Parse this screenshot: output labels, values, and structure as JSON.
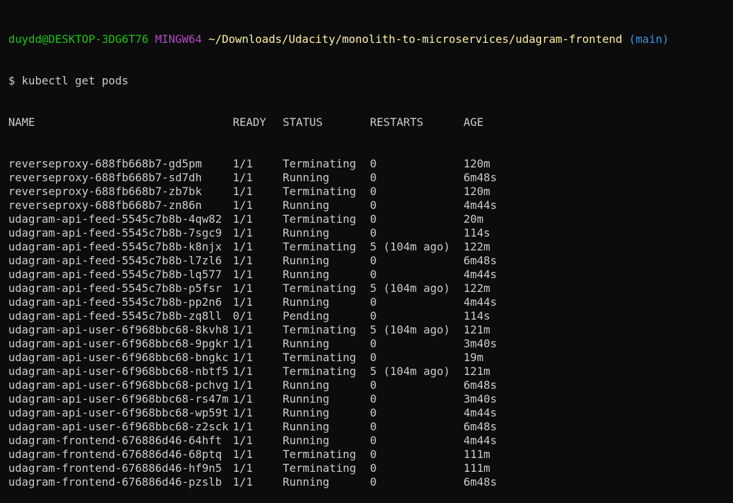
{
  "prompt": {
    "user_host": "duydd@DESKTOP-3DG6T76",
    "system": "MINGW64",
    "path": "~/Downloads/Udacity/monolith-to-microservices/udagram-frontend",
    "branch": "(main)"
  },
  "command": {
    "symbol": "$",
    "text": "kubectl get pods"
  },
  "table": {
    "headers": [
      "NAME",
      "READY",
      "STATUS",
      "RESTARTS",
      "AGE"
    ],
    "rows": [
      [
        "reverseproxy-688fb668b7-gd5pm",
        "1/1",
        "Terminating",
        "0",
        "120m"
      ],
      [
        "reverseproxy-688fb668b7-sd7dh",
        "1/1",
        "Running",
        "0",
        "6m48s"
      ],
      [
        "reverseproxy-688fb668b7-zb7bk",
        "1/1",
        "Terminating",
        "0",
        "120m"
      ],
      [
        "reverseproxy-688fb668b7-zn86n",
        "1/1",
        "Running",
        "0",
        "4m44s"
      ],
      [
        "udagram-api-feed-5545c7b8b-4qw82",
        "1/1",
        "Terminating",
        "0",
        "20m"
      ],
      [
        "udagram-api-feed-5545c7b8b-7sgc9",
        "1/1",
        "Running",
        "0",
        "114s"
      ],
      [
        "udagram-api-feed-5545c7b8b-k8njx",
        "1/1",
        "Terminating",
        "5 (104m ago)",
        "122m"
      ],
      [
        "udagram-api-feed-5545c7b8b-l7zl6",
        "1/1",
        "Running",
        "0",
        "6m48s"
      ],
      [
        "udagram-api-feed-5545c7b8b-lq577",
        "1/1",
        "Running",
        "0",
        "4m44s"
      ],
      [
        "udagram-api-feed-5545c7b8b-p5fsr",
        "1/1",
        "Terminating",
        "5 (104m ago)",
        "122m"
      ],
      [
        "udagram-api-feed-5545c7b8b-pp2n6",
        "1/1",
        "Running",
        "0",
        "4m44s"
      ],
      [
        "udagram-api-feed-5545c7b8b-zq8ll",
        "0/1",
        "Pending",
        "0",
        "114s"
      ],
      [
        "udagram-api-user-6f968bbc68-8kvh8",
        "1/1",
        "Terminating",
        "5 (104m ago)",
        "121m"
      ],
      [
        "udagram-api-user-6f968bbc68-9pgkr",
        "1/1",
        "Running",
        "0",
        "3m40s"
      ],
      [
        "udagram-api-user-6f968bbc68-bngkc",
        "1/1",
        "Terminating",
        "0",
        "19m"
      ],
      [
        "udagram-api-user-6f968bbc68-nbtf5",
        "1/1",
        "Terminating",
        "5 (104m ago)",
        "121m"
      ],
      [
        "udagram-api-user-6f968bbc68-pchvg",
        "1/1",
        "Running",
        "0",
        "6m48s"
      ],
      [
        "udagram-api-user-6f968bbc68-rs47m",
        "1/1",
        "Running",
        "0",
        "3m40s"
      ],
      [
        "udagram-api-user-6f968bbc68-wp59t",
        "1/1",
        "Running",
        "0",
        "4m44s"
      ],
      [
        "udagram-api-user-6f968bbc68-z2sck",
        "1/1",
        "Running",
        "0",
        "6m48s"
      ],
      [
        "udagram-frontend-676886d46-64hft",
        "1/1",
        "Running",
        "0",
        "4m44s"
      ],
      [
        "udagram-frontend-676886d46-68ptq",
        "1/1",
        "Terminating",
        "0",
        "111m"
      ],
      [
        "udagram-frontend-676886d46-hf9n5",
        "1/1",
        "Terminating",
        "0",
        "111m"
      ],
      [
        "udagram-frontend-676886d46-pzslb",
        "1/1",
        "Running",
        "0",
        "6m48s"
      ]
    ]
  },
  "colors": {
    "background": "#0c0c0c",
    "foreground": "#cccccc",
    "user_host": "#16c60c",
    "system": "#b148c6",
    "path": "#f9f1a5",
    "branch": "#3a96dd"
  }
}
